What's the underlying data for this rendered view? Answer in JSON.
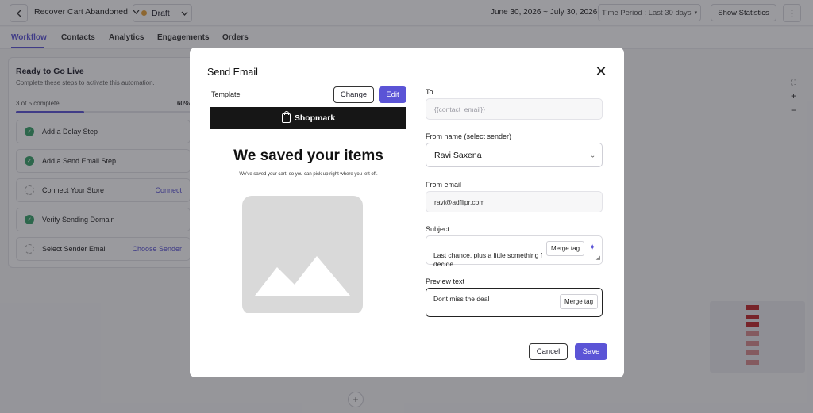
{
  "topbar": {
    "automation_name": "Recover Cart Abandoned",
    "status": "Draft",
    "date_range": "June 30, 2026 ~ July 30, 2026",
    "time_period": "Time Period : Last 30 days",
    "show_statistics": "Show Statistics"
  },
  "tabs": [
    "Workflow",
    "Contacts",
    "Analytics",
    "Engagements",
    "Orders"
  ],
  "checklist": {
    "title": "Ready to Go Live",
    "subtitle": "Complete these steps to activate this automation.",
    "progress_text": "3 of 5 complete",
    "progress_pct": "60%",
    "progress_fraction": 0.6,
    "steps": [
      {
        "label": "Add a Delay Step",
        "done": true,
        "action": ""
      },
      {
        "label": "Add a Send Email Step",
        "done": true,
        "action": ""
      },
      {
        "label": "Connect Your Store",
        "done": false,
        "action": "Connect"
      },
      {
        "label": "Verify Sending Domain",
        "done": true,
        "action": ""
      },
      {
        "label": "Select Sender Email",
        "done": false,
        "action": "Choose Sender"
      }
    ]
  },
  "modal": {
    "title": "Send Email",
    "template_label": "Template",
    "change_label": "Change",
    "edit_label": "Edit",
    "preview": {
      "brand": "Shopmark",
      "heading": "We saved your items",
      "subtext": "We've saved your cart, so you can pick up right where you left off."
    },
    "to_label": "To",
    "to_value": "{{contact_email}}",
    "from_name_label": "From name (select sender)",
    "from_name_value": "Ravi Saxena",
    "from_email_label": "From email",
    "from_email_value": "ravi@adflipr.com",
    "subject_label": "Subject",
    "subject_value": "Last chance, plus a little something f\ndecide",
    "preview_text_label": "Preview text",
    "preview_text_value": "Dont miss the deal",
    "merge_tag_label": "Merge tag",
    "cancel_label": "Cancel",
    "save_label": "Save"
  },
  "colors": {
    "accent": "#5b54d6",
    "success": "#3aa36a",
    "draft": "#e8a33a"
  }
}
